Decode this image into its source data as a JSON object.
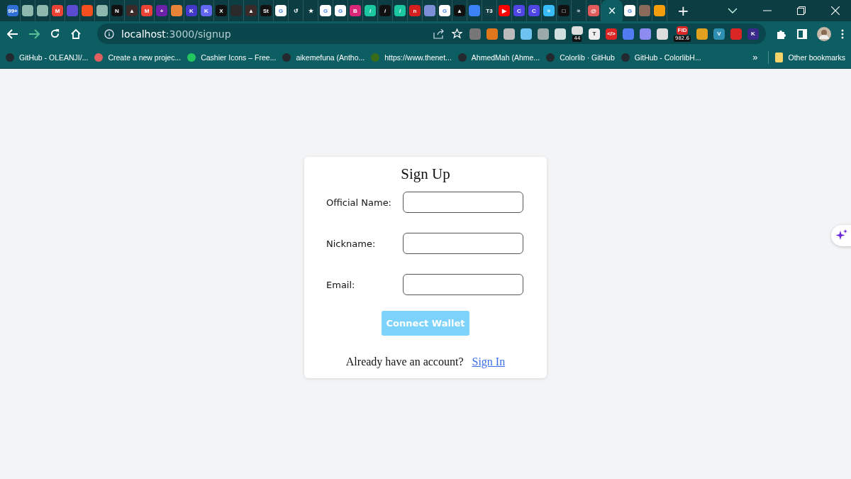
{
  "tabs": [
    {
      "selected": false,
      "color": "#2f6fd6",
      "text": "99+"
    },
    {
      "selected": false,
      "color": "#8fb8ac"
    },
    {
      "selected": false,
      "color": "#8fb8ac"
    },
    {
      "selected": false,
      "color": "#ea4335",
      "text": "M"
    },
    {
      "selected": false,
      "color": "#5b4bd1"
    },
    {
      "selected": false,
      "color": "#f24e1e"
    },
    {
      "selected": false,
      "color": "#8fb8ac"
    },
    {
      "selected": false,
      "color": "#111111",
      "text": "N"
    },
    {
      "selected": false,
      "color": "#3a2a2a",
      "text": "▲"
    },
    {
      "selected": false,
      "color": "#ea4335",
      "text": "M"
    },
    {
      "selected": false,
      "color": "#6b21a8",
      "text": "+"
    },
    {
      "selected": false,
      "color": "#e8833a"
    },
    {
      "selected": false,
      "color": "#4338ca",
      "text": "K"
    },
    {
      "selected": false,
      "color": "#6366f1",
      "text": "K"
    },
    {
      "selected": false,
      "color": "#111111",
      "text": "X"
    },
    {
      "selected": false,
      "color": "#2a2a2a"
    },
    {
      "selected": false,
      "color": "#3a2a2a",
      "text": "▲"
    },
    {
      "selected": false,
      "color": "#111111",
      "text": "St"
    },
    {
      "selected": false,
      "color": "#ffffff",
      "text": "G"
    },
    {
      "selected": false,
      "color": "#0b3d43",
      "text": "↺"
    },
    {
      "selected": false,
      "color": "#0b3d43",
      "text": "★"
    },
    {
      "selected": false,
      "color": "#ffffff",
      "text": "G"
    },
    {
      "selected": false,
      "color": "#ffffff",
      "text": "G"
    },
    {
      "selected": false,
      "color": "#db2777",
      "text": "B"
    },
    {
      "selected": false,
      "color": "#1cc8a0",
      "text": "/"
    },
    {
      "selected": false,
      "color": "#111111",
      "text": "/"
    },
    {
      "selected": false,
      "color": "#1cc8a0",
      "text": "/"
    },
    {
      "selected": false,
      "color": "#d61f1f",
      "text": "n"
    },
    {
      "selected": false,
      "color": "#7c8fd6"
    },
    {
      "selected": false,
      "color": "#ffffff",
      "text": "G"
    },
    {
      "selected": false,
      "color": "#111111",
      "text": "▲"
    },
    {
      "selected": false,
      "color": "#3b82f6"
    },
    {
      "selected": false,
      "color": "#123f44",
      "text": "T3"
    },
    {
      "selected": false,
      "color": "#ff0000",
      "text": "▶"
    },
    {
      "selected": false,
      "color": "#4f46e5",
      "text": "C"
    },
    {
      "selected": false,
      "color": "#4f46e5",
      "text": "C"
    },
    {
      "selected": false,
      "color": "#38bdf8",
      "text": "≈"
    },
    {
      "selected": false,
      "color": "#111111",
      "text": "□"
    },
    {
      "selected": false,
      "color": "#0b3d43",
      "text": "≈"
    },
    {
      "selected": false,
      "color": "#e25a5a",
      "text": "@"
    },
    {
      "selected": true,
      "text": "×"
    },
    {
      "selected": false,
      "color": "#ffffff",
      "text": "G"
    },
    {
      "selected": false,
      "color": "#8a6a5a"
    },
    {
      "selected": false,
      "color": "#f59e0b"
    }
  ],
  "new_tab": "+",
  "address": {
    "host": "localhost",
    "path": ":3000/signup"
  },
  "extensions": [
    {
      "color": "#777777"
    },
    {
      "color": "#e2761b"
    },
    {
      "color": "#bbbbbb"
    },
    {
      "color": "#6cc3f0"
    },
    {
      "color": "#9aa9a9"
    },
    {
      "color": "#cfdede"
    },
    {
      "color": "#dddddd",
      "badge": "44"
    },
    {
      "color": "#eeeeee",
      "text": "T"
    },
    {
      "color": "#dc2626",
      "text": "</>"
    },
    {
      "color": "#4f7cf2"
    },
    {
      "color": "#8b8bf0"
    },
    {
      "color": "#dddddd"
    },
    {
      "color": "#dc2626",
      "text": "FID",
      "badge": "982.6"
    },
    {
      "color": "#e0a020"
    },
    {
      "color": "#2f8fb0",
      "text": "V"
    },
    {
      "color": "#dc2626"
    },
    {
      "color": "#3b2a8a",
      "text": "K"
    }
  ],
  "bookmarks": [
    {
      "label": "GitHub - OLEANJI/...",
      "color": "#24292f"
    },
    {
      "label": "Create a new projec...",
      "color": "#e06060"
    },
    {
      "label": "Cashier Icons – Free...",
      "color": "#22c55e"
    },
    {
      "label": "aikemefuna (Antho...",
      "color": "#24292f"
    },
    {
      "label": "https://www.thenet...",
      "color": "#3a6b1a"
    },
    {
      "label": "AhmedMah (Ahme...",
      "color": "#24292f"
    },
    {
      "label": "Colorlib · GitHub",
      "color": "#24292f"
    },
    {
      "label": "GitHub - ColorlibH...",
      "color": "#24292f"
    }
  ],
  "more_bookmarks": "»",
  "other_bookmarks": "Other bookmarks",
  "form": {
    "title": "Sign Up",
    "fields": [
      {
        "label": "Official Name:"
      },
      {
        "label": "Nickname:"
      },
      {
        "label": "Email:"
      }
    ],
    "button": {
      "label": "Connect Wallet",
      "disabled": true
    },
    "footer": {
      "text": "Already have an account?",
      "link": "Sign In"
    }
  }
}
